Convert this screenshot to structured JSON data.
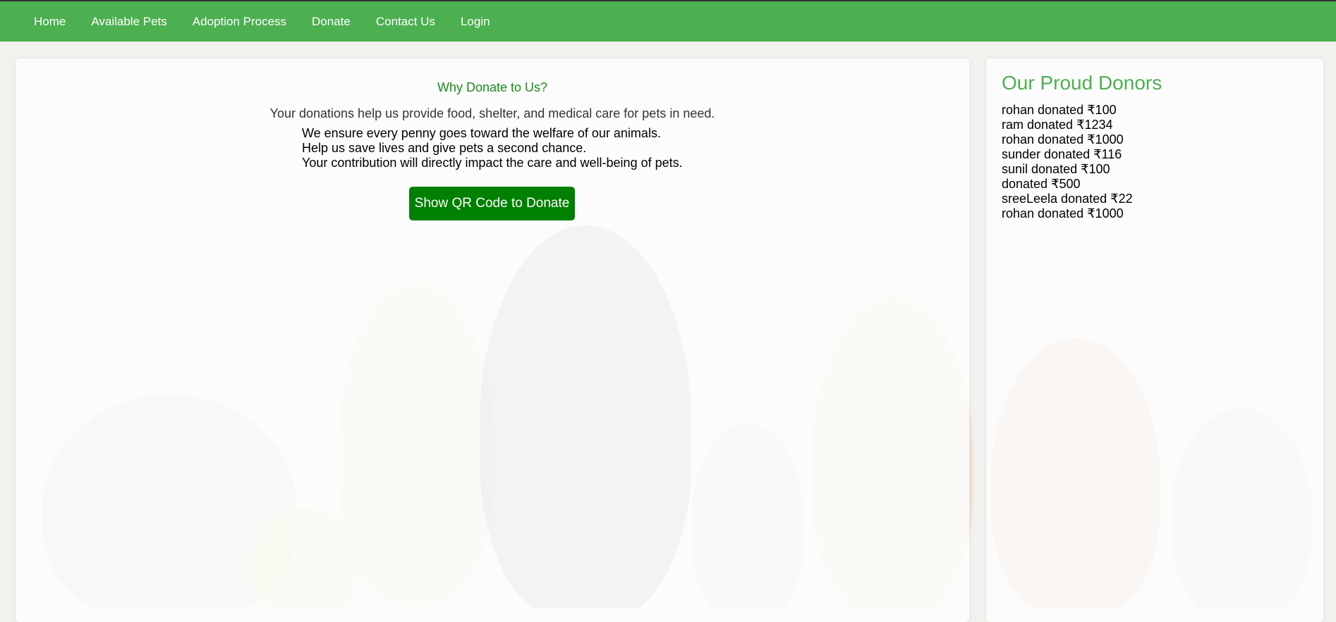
{
  "nav": {
    "items": [
      {
        "label": "Home"
      },
      {
        "label": "Available Pets"
      },
      {
        "label": "Adoption Process"
      },
      {
        "label": "Donate"
      },
      {
        "label": "Contact Us"
      },
      {
        "label": "Login"
      }
    ]
  },
  "main": {
    "title": "Why Donate to Us?",
    "intro": "Your donations help us provide food, shelter, and medical care for pets in need.",
    "points": [
      "We ensure every penny goes toward the welfare of our animals.",
      "Help us save lives and give pets a second chance.",
      "Your contribution will directly impact the care and well-being of pets."
    ],
    "button_label": "Show QR Code to Donate"
  },
  "sidebar": {
    "title": "Our Proud Donors",
    "donors": [
      "rohan donated ₹100",
      "ram donated ₹1234",
      "rohan donated ₹1000",
      "sunder donated ₹116",
      "sunil donated ₹100",
      "donated ₹500",
      "sreeLeela donated ₹22",
      "rohan donated ₹1000"
    ]
  },
  "colors": {
    "nav_bg": "#4caf50",
    "accent_green": "#008000",
    "title_green": "#1a8a1a"
  }
}
